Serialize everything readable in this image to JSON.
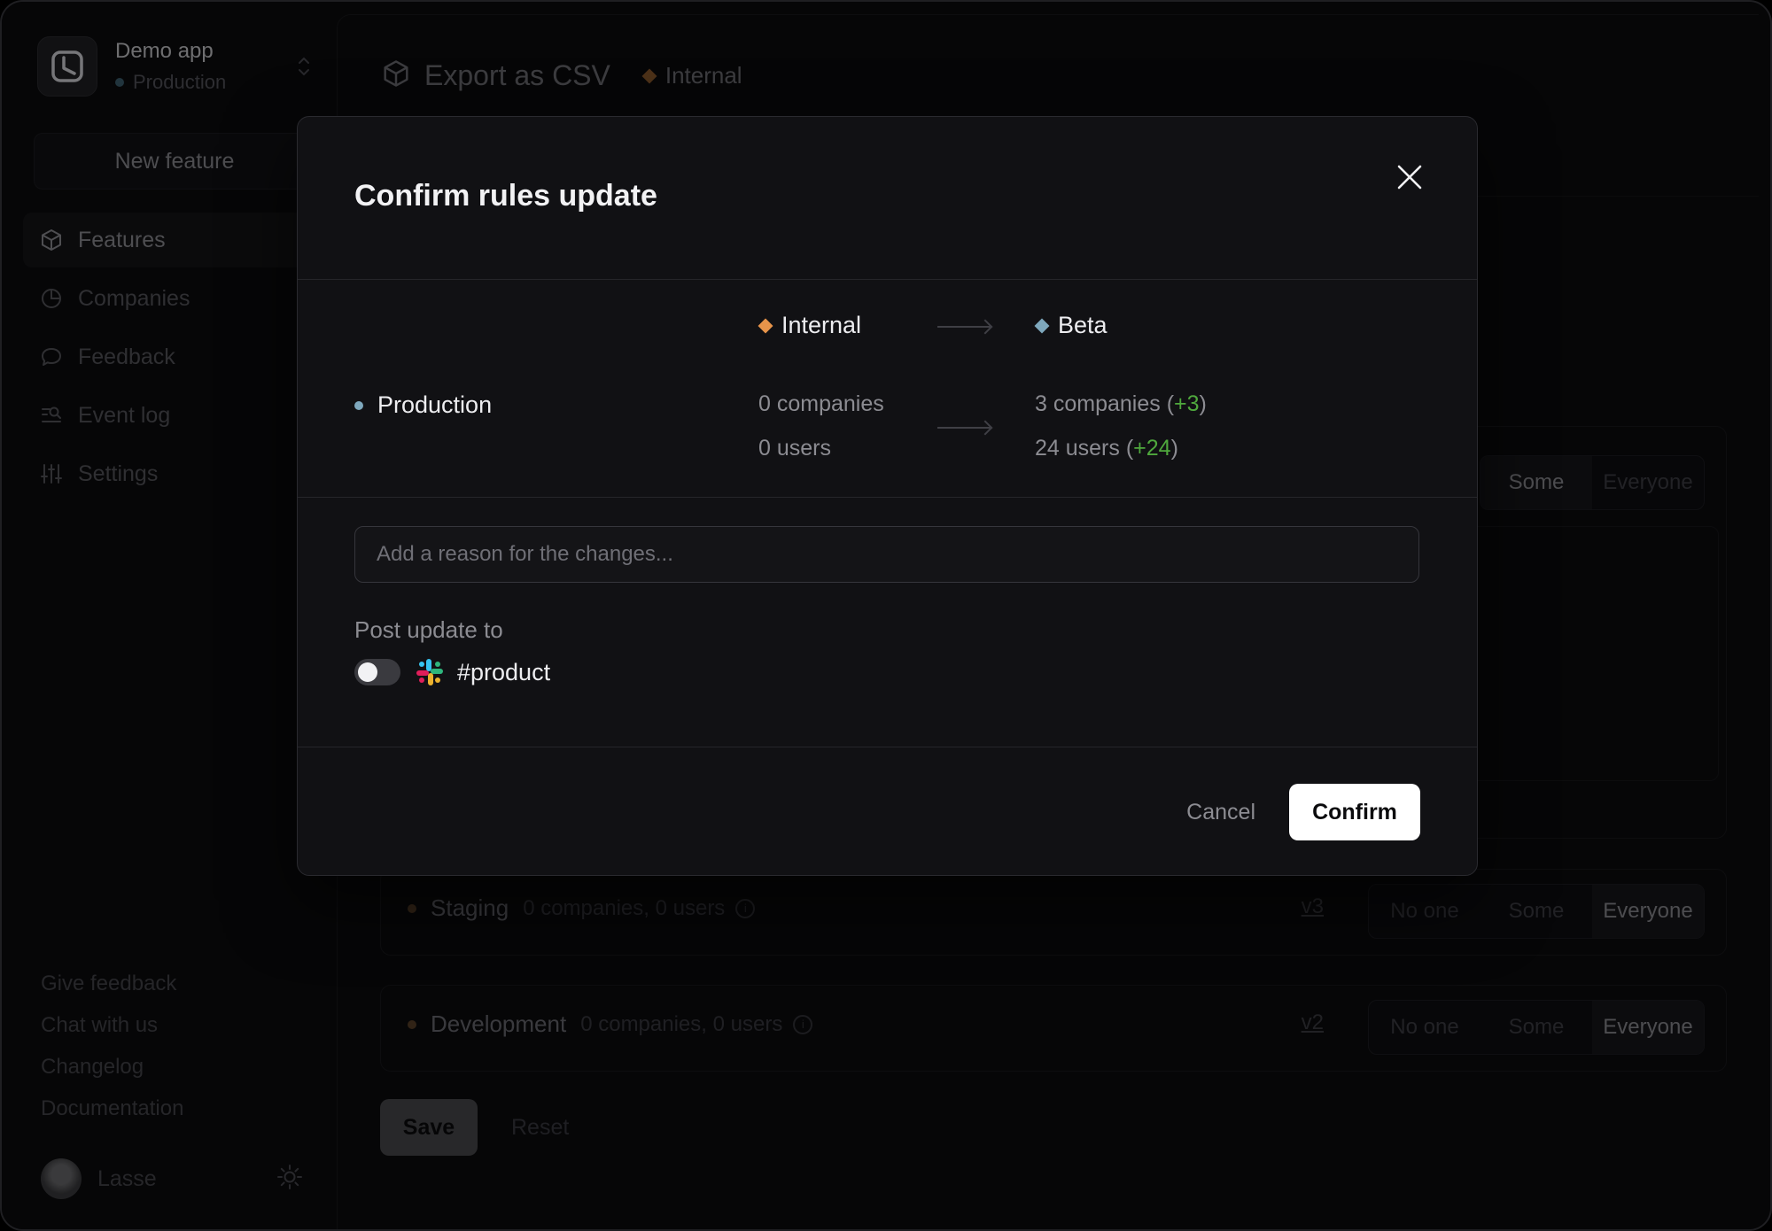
{
  "app": {
    "name": "Demo app",
    "environment": "Production"
  },
  "sidebar": {
    "new_feature_label": "New feature",
    "items": [
      {
        "label": "Features",
        "icon": "box-icon",
        "active": true
      },
      {
        "label": "Companies",
        "icon": "pie-chart-icon"
      },
      {
        "label": "Feedback",
        "icon": "chat-bubble-icon"
      },
      {
        "label": "Event log",
        "icon": "log-search-icon"
      },
      {
        "label": "Settings",
        "icon": "sliders-icon"
      }
    ],
    "footer_links": [
      "Give feedback",
      "Chat with us",
      "Changelog",
      "Documentation"
    ],
    "user": {
      "name": "Lasse"
    }
  },
  "feature": {
    "title": "Export as CSV",
    "stage": "Internal"
  },
  "environments": {
    "production_segment": {
      "options": [
        "Some",
        "Everyone"
      ],
      "selected": "Some"
    },
    "staging": {
      "name": "Staging",
      "counts": "0 companies, 0 users",
      "version": "v3",
      "options": [
        "No one",
        "Some",
        "Everyone"
      ],
      "selected": "Everyone"
    },
    "development": {
      "name": "Development",
      "counts": "0 companies, 0 users",
      "version": "v2",
      "options": [
        "No one",
        "Some",
        "Everyone"
      ],
      "selected": "Everyone"
    }
  },
  "actions": {
    "save": "Save",
    "reset": "Reset"
  },
  "modal": {
    "title": "Confirm rules update",
    "from_stage": "Internal",
    "to_stage": "Beta",
    "environment": "Production",
    "from_companies": "0 companies",
    "from_users": "0 users",
    "to_companies": "3 companies",
    "to_companies_delta": "+3",
    "to_users": "24 users",
    "to_users_delta": "+24",
    "reason_placeholder": "Add a reason for the changes...",
    "reason_value": "",
    "post_label": "Post update to",
    "channel": "#product",
    "post_enabled": false,
    "cancel": "Cancel",
    "confirm": "Confirm"
  },
  "colors": {
    "internal": "#e8944a",
    "beta": "#7ea8bd",
    "production": "#7ea8bd",
    "positive": "#4fa83d",
    "staging_dot": "#5a4128"
  }
}
